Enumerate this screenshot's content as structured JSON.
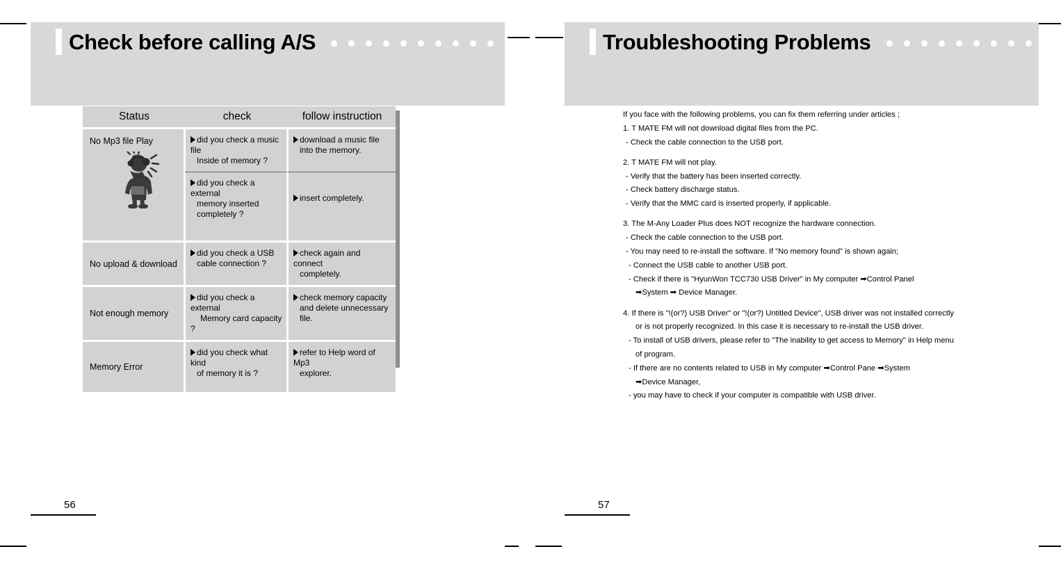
{
  "spread": {
    "left_page": {
      "chapter_title": "Check before calling A/S",
      "dot_count": 12,
      "page_number": "56",
      "table": {
        "headers": [
          "Status",
          "check",
          "follow instruction"
        ],
        "rows": [
          {
            "status": "No Mp3 file Play",
            "has_figure": true,
            "figure_name": "person-with-headphones-illustration",
            "sub_rows": [
              {
                "check": [
                  "did you check a music file",
                  "Inside of memory ?"
                ],
                "follow": [
                  "download a music file",
                  "into the memory."
                ]
              },
              {
                "check": [
                  "did you check a external",
                  "memory inserted",
                  "completely ?"
                ],
                "follow": [
                  "insert completely."
                ]
              }
            ]
          },
          {
            "status": "No upload & download",
            "has_figure": false,
            "sub_rows": [
              {
                "check": [
                  "did you check a USB",
                  "cable connection ?"
                ],
                "follow": [
                  "check again and connect",
                  "completely."
                ]
              }
            ]
          },
          {
            "status": "Not enough memory",
            "has_figure": false,
            "sub_rows": [
              {
                "check": [
                  "did you check a external",
                  "Memory card capacity ?"
                ],
                "follow": [
                  "check memory capacity",
                  "and delete unnecessary",
                  "file."
                ]
              }
            ]
          },
          {
            "status": "Memory Error",
            "has_figure": false,
            "sub_rows": [
              {
                "check": [
                  "did  you check what kind",
                  "of memory it is ?"
                ],
                "follow": [
                  "refer to Help word of Mp3",
                  "explorer."
                ]
              }
            ]
          }
        ]
      }
    },
    "right_page": {
      "chapter_title": "Troubleshooting Problems",
      "dot_count": 12,
      "page_number": "57",
      "intro": "If you face with the following problems, you can fix them referring under articles ;",
      "items": [
        {
          "heading": "1. T MATE FM will not download digital files from the PC.",
          "lines": [
            "-  Check the cable connection to the USB port."
          ]
        },
        {
          "heading": "2. T MATE FM will not play.",
          "lines": [
            "-  Verify that the battery has been inserted correctly.",
            "-  Check battery discharge status.",
            "-  Verify that the MMC card is inserted properly, if applicable."
          ]
        },
        {
          "heading": "3. The M-Any Loader Plus does NOT recognize the hardware connection.",
          "lines": [
            "-  Check the cable connection to the USB port.",
            "-  You may need to re-install the software. If \"No memory found\" is shown again;",
            "- Connect the USB cable to another USB port.",
            "- Check if there is \"HyunWon TCC730 USB Driver\" in My computer ➡Control Panel",
            "➡System  ➡  Device Manager."
          ]
        },
        {
          "heading": "4. If there is \"!(or?) USB Driver\" or \"!(or?) Untitled Device\", USB driver was not installed correctly",
          "lines": [
            "or is not properly recognized. In this case it is necessary to re-install the USB driver.",
            "- To install of USB drivers, please refer to \"The inability to get access to Memory\" in Help menu",
            "of program.",
            "- If there are no contents related to USB in My computer  ➡Control Pane ➡System",
            "➡Device Manager,",
            "- you may have to check if your computer is compatible with USB driver."
          ]
        }
      ]
    }
  },
  "colors": {
    "band_gray": "#d8d8d8",
    "cell_gray": "#d2d2d2",
    "shadow_gray": "#8e8e8e",
    "text_black": "#000000",
    "page_white": "#ffffff"
  }
}
